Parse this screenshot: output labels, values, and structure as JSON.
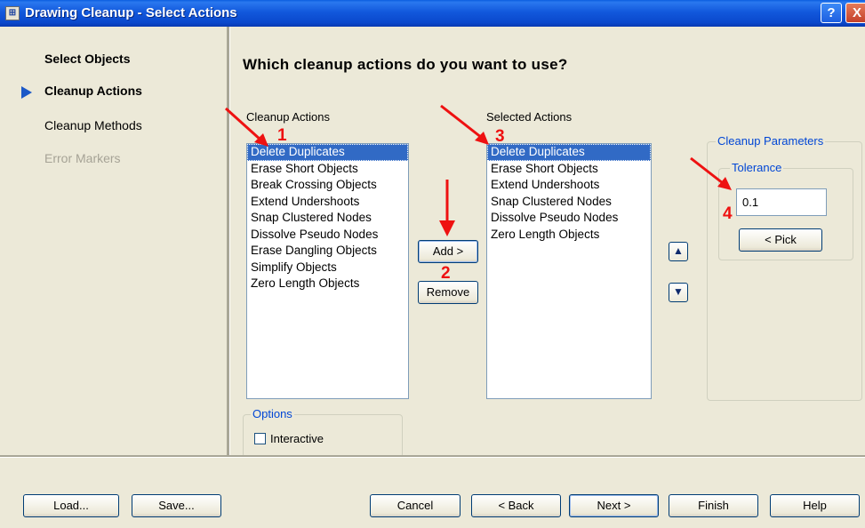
{
  "window": {
    "title": "Drawing Cleanup - Select Actions",
    "help_label": "?",
    "close_label": "X"
  },
  "sidebar": {
    "steps": [
      {
        "label": "Select Objects",
        "state": "completed"
      },
      {
        "label": "Cleanup Actions",
        "state": "current"
      },
      {
        "label": "Cleanup Methods",
        "state": "upcoming"
      },
      {
        "label": "Error Markers",
        "state": "disabled"
      }
    ]
  },
  "main": {
    "heading": "Which cleanup actions do you want to use?",
    "available": {
      "label": "Cleanup Actions",
      "items": [
        "Delete Duplicates",
        "Erase Short Objects",
        "Break Crossing Objects",
        "Extend Undershoots",
        "Snap Clustered Nodes",
        "Dissolve Pseudo Nodes",
        "Erase Dangling Objects",
        "Simplify Objects",
        "Zero Length Objects"
      ],
      "selected_index": 0
    },
    "add_label": "Add >",
    "remove_label": "Remove",
    "selected": {
      "label": "Selected Actions",
      "items": [
        "Delete Duplicates",
        "Erase Short Objects",
        "Extend Undershoots",
        "Snap Clustered Nodes",
        "Dissolve Pseudo Nodes",
        "Zero Length Objects"
      ],
      "selected_index": 0
    },
    "move_up_icon": "up-arrow-icon",
    "move_down_icon": "down-arrow-icon",
    "parameters": {
      "title": "Cleanup Parameters",
      "tolerance_label": "Tolerance",
      "tolerance_value": "0.1",
      "pick_label": "< Pick"
    },
    "options": {
      "title": "Options",
      "interactive_label": "Interactive",
      "interactive_checked": false
    }
  },
  "annotations": {
    "markers": [
      "1",
      "2",
      "3",
      "4"
    ],
    "color": "#ee1111"
  },
  "footer": {
    "load_label": "Load...",
    "save_label": "Save...",
    "cancel_label": "Cancel",
    "back_label": "< Back",
    "next_label": "Next >",
    "finish_label": "Finish",
    "help_label": "Help"
  },
  "colors": {
    "title_bar": "#0a48cc",
    "selection": "#316ac5",
    "group_title": "#0046d5",
    "dialog_bg": "#ece9d8"
  }
}
